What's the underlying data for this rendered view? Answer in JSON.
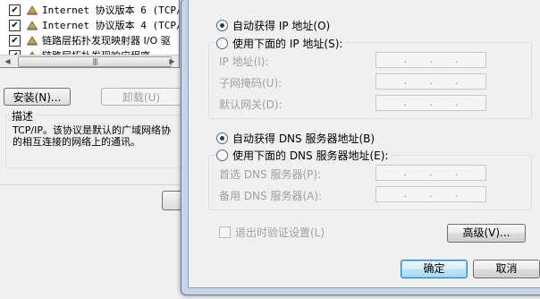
{
  "background_window": {
    "components": [
      {
        "label": "Internet 协议版本 6 (TCP/I",
        "checked": true,
        "icon": "network-protocol-icon"
      },
      {
        "label": "Internet 协议版本 4 (TCP/I",
        "checked": true,
        "icon": "network-protocol-icon"
      },
      {
        "label": "链路层拓扑发现映射器 I/O 驱",
        "checked": true,
        "icon": "network-protocol-icon"
      },
      {
        "label": "链路层拓扑发现响应程序",
        "checked": true,
        "icon": "network-protocol-icon"
      }
    ],
    "check_mark": "✔",
    "scroll_left": "◀",
    "scroll_right": "▶",
    "scroll_grip": "|||",
    "install_label": "安装(N)...",
    "uninstall_label": "卸载(U)",
    "description_legend": "描述",
    "description_line1": "TCP/IP。该协议是默认的广域网络协",
    "description_line2": "的相互连接的网络上的通讯。"
  },
  "ipv4_dialog": {
    "auto_ip_label": "自动获得 IP 地址(O)",
    "manual_ip_label": "使用下面的 IP 地址(S):",
    "ip_address_label": "IP 地址(I):",
    "subnet_mask_label": "子网掩码(U):",
    "default_gateway_label": "默认网关(D):",
    "ip_dots": [
      ".",
      ".",
      "."
    ],
    "auto_dns_label": "自动获得 DNS 服务器地址(B)",
    "manual_dns_label": "使用下面的 DNS 服务器地址(E):",
    "preferred_dns_label": "首选 DNS 服务器(P):",
    "alternate_dns_label": "备用 DNS 服务器(A):",
    "validate_on_exit_label": "退出时验证设置(L)",
    "advanced_label": "高级(V)...",
    "ok_label": "确定",
    "cancel_label": "取消",
    "selected_ip_mode": "auto",
    "selected_dns_mode": "auto"
  },
  "colors": {
    "dialog_frame": "#c6d6ea",
    "default_button_border": "#3c7fb1",
    "disabled_text": "#a0a0a0"
  }
}
